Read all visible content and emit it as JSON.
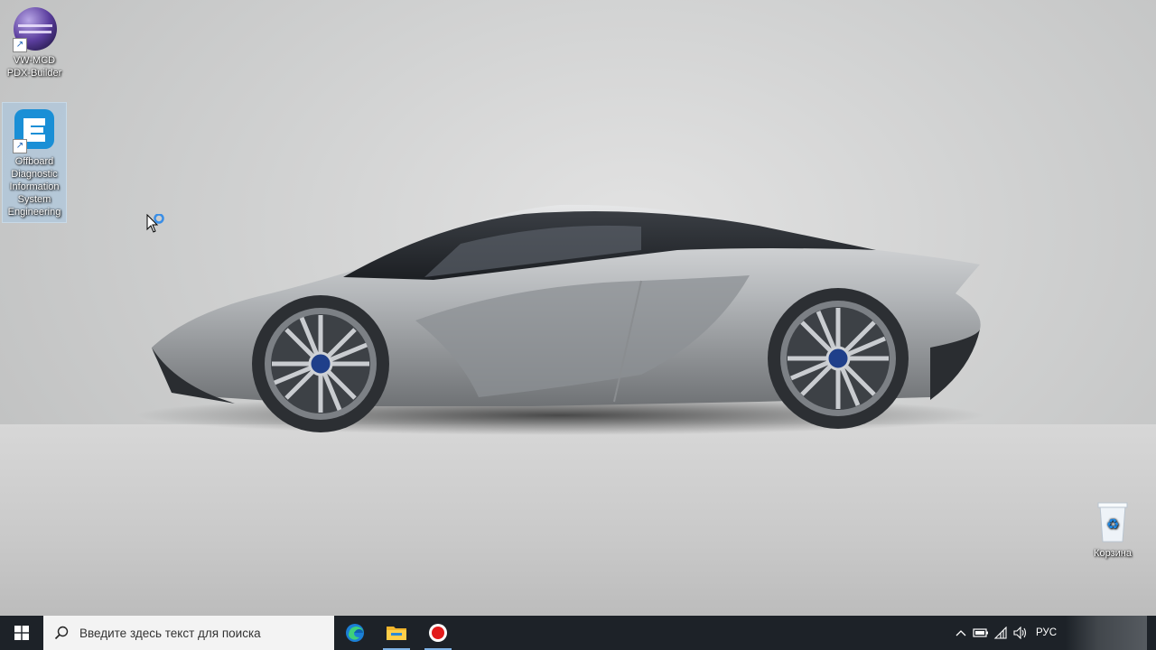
{
  "desktop": {
    "icons": [
      {
        "label_line1": "VW-MCD",
        "label_line2": "PDX-Builder",
        "icon": "eclipse-sphere-icon"
      },
      {
        "label_lines": [
          "Offboard",
          "Diagnostic",
          "Information",
          "System",
          "Engineering"
        ],
        "icon": "odis-e-logo-icon"
      },
      {
        "label": "Корзина",
        "icon": "recycle-bin-icon"
      }
    ]
  },
  "taskbar": {
    "search_placeholder": "Введите здесь текст для поиска",
    "apps": [
      {
        "name": "Microsoft Edge",
        "icon": "edge-icon"
      },
      {
        "name": "File Explorer",
        "icon": "folder-icon"
      },
      {
        "name": "Screen recorder",
        "icon": "record-icon"
      }
    ],
    "tray": {
      "language": "РУС",
      "icons": [
        "chevron-up-icon",
        "battery-icon",
        "wifi-icon",
        "volume-icon"
      ]
    }
  },
  "colors": {
    "taskbar_bg": "#1d2228",
    "search_bg": "#f3f3f3",
    "accent": "#0078d7"
  }
}
